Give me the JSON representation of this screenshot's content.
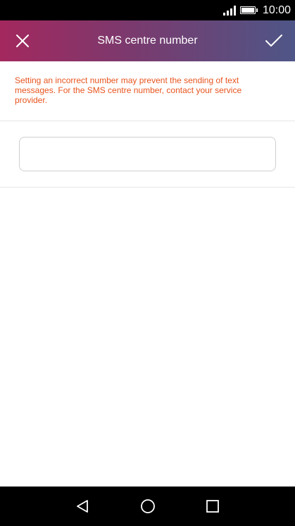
{
  "status_bar": {
    "time": "10:00",
    "icons": [
      "signal-icon",
      "battery-icon"
    ]
  },
  "app_bar": {
    "title": "SMS centre number",
    "left_icon": "close-icon",
    "right_icon": "check-icon",
    "gradient_colors": [
      "#a3285e",
      "#4e5687"
    ]
  },
  "content": {
    "warning_text": "Setting an incorrect number may prevent the sending of text messages. For the SMS centre number, contact your service provider.",
    "warning_color": "#e8541e",
    "input": {
      "value": "",
      "placeholder": ""
    }
  },
  "nav_bar": {
    "icons": [
      "back-icon",
      "home-icon",
      "recents-icon"
    ]
  }
}
